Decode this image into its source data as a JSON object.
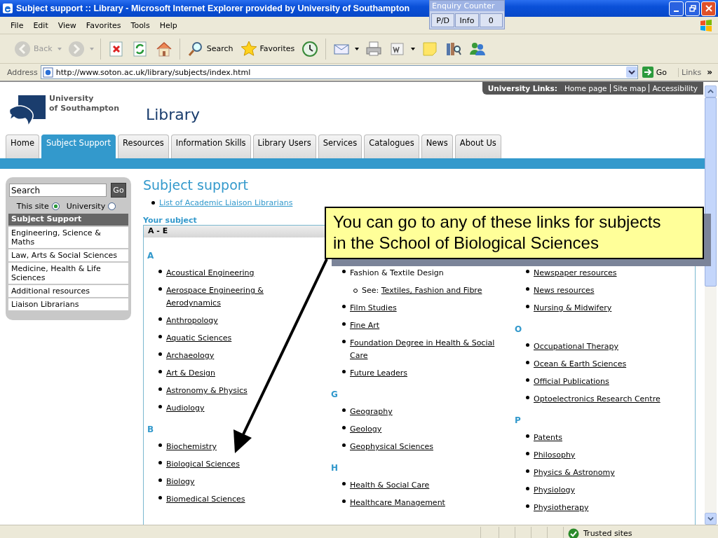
{
  "window": {
    "title": "Subject support :: Library - Microsoft Internet Explorer provided by University of Southampton"
  },
  "enquiry_counter": {
    "title": "Enquiry Counter",
    "buttons": [
      "P/D",
      "Info",
      "0"
    ]
  },
  "menu": [
    "File",
    "Edit",
    "View",
    "Favorites",
    "Tools",
    "Help"
  ],
  "toolbar": [
    {
      "kind": "back",
      "label": "Back",
      "disabled": true,
      "dropdown": true
    },
    {
      "kind": "forward",
      "disabled": true,
      "dropdown": true
    },
    {
      "kind": "stop",
      "disabled": false,
      "dropdown": false
    },
    {
      "kind": "refresh",
      "disabled": false,
      "dropdown": false
    },
    {
      "kind": "home",
      "disabled": false,
      "dropdown": false
    },
    {
      "kind": "search",
      "label": "Search",
      "disabled": false,
      "dropdown": false
    },
    {
      "kind": "favorites",
      "label": "Favorites",
      "disabled": false,
      "dropdown": false
    },
    {
      "kind": "history",
      "disabled": false,
      "dropdown": false
    },
    {
      "kind": "mail",
      "disabled": false,
      "dropdown": true
    },
    {
      "kind": "print",
      "disabled": false,
      "dropdown": false
    },
    {
      "kind": "edit",
      "disabled": false,
      "dropdown": true
    },
    {
      "kind": "note",
      "disabled": false,
      "dropdown": false
    },
    {
      "kind": "research",
      "disabled": false,
      "dropdown": false
    },
    {
      "kind": "messenger",
      "disabled": false,
      "dropdown": false
    }
  ],
  "address": {
    "label": "Address",
    "url": "http://www.soton.ac.uk/library/subjects/index.html",
    "go": "Go",
    "links": "Links",
    "more": "»"
  },
  "page": {
    "university_links": {
      "label": "University Links:",
      "links": [
        "Home page",
        "Site map",
        "Accessibility"
      ]
    },
    "logo_text": [
      "University",
      "of Southampton"
    ],
    "site_title": "Library",
    "tabs": [
      {
        "label": "Home",
        "selected": false
      },
      {
        "label": "Subject Support",
        "selected": true
      },
      {
        "label": "Resources",
        "selected": false
      },
      {
        "label": "Information Skills",
        "selected": false
      },
      {
        "label": "Library Users",
        "selected": false
      },
      {
        "label": "Services",
        "selected": false
      },
      {
        "label": "Catalogues",
        "selected": false
      },
      {
        "label": "News",
        "selected": false
      },
      {
        "label": "About Us",
        "selected": false
      }
    ],
    "sidebar": {
      "search_value": "Search",
      "go": "Go",
      "scopes": [
        {
          "label": "This site",
          "selected": true
        },
        {
          "label": "University",
          "selected": false
        }
      ],
      "heading": "Subject Support",
      "items": [
        "Engineering, Science & Maths",
        "Law, Arts & Social Sciences",
        "Medicine, Health & Life Sciences",
        "Additional resources",
        "Liaison Librarians"
      ]
    },
    "content": {
      "title": "Subject support",
      "links": [
        "List of Academic Liaison Librarians"
      ],
      "subheading": "Your subject",
      "panel_header": "A - E",
      "columns": [
        [
          {
            "heading": "A",
            "items": [
              {
                "kind": "link",
                "text": "Acoustical Engineering"
              },
              {
                "kind": "link",
                "text": "Aerospace Engineering & Aerodynamics"
              },
              {
                "kind": "link",
                "text": "Anthropology"
              },
              {
                "kind": "link",
                "text": "Aquatic Sciences"
              },
              {
                "kind": "link",
                "text": "Archaeology"
              },
              {
                "kind": "link",
                "text": "Art & Design"
              },
              {
                "kind": "link",
                "text": "Astronomy & Physics"
              },
              {
                "kind": "link",
                "text": "Audiology"
              }
            ]
          },
          {
            "heading": "B",
            "items": [
              {
                "kind": "link",
                "text": "Biochemistry"
              },
              {
                "kind": "link",
                "text": "Biological Sciences"
              },
              {
                "kind": "link",
                "text": "Biology"
              },
              {
                "kind": "link",
                "text": "Biomedical Sciences"
              }
            ]
          }
        ],
        [
          {
            "items": [
              {
                "kind": "plain",
                "text": "Fashion & Textile Design",
                "children": [
                  {
                    "prefix": "See:",
                    "text": "Textiles, Fashion and Fibre"
                  }
                ]
              },
              {
                "kind": "link",
                "text": "Film Studies"
              },
              {
                "kind": "link",
                "text": "Fine Art"
              },
              {
                "kind": "link",
                "text": "Foundation Degree in Health & Social Care"
              },
              {
                "kind": "link",
                "text": "Future Leaders"
              }
            ]
          },
          {
            "heading": "G",
            "items": [
              {
                "kind": "link",
                "text": "Geography"
              },
              {
                "kind": "link",
                "text": "Geology"
              },
              {
                "kind": "link",
                "text": "Geophysical Sciences"
              }
            ]
          },
          {
            "heading": "H",
            "items": [
              {
                "kind": "link",
                "text": "Health & Social Care"
              },
              {
                "kind": "link",
                "text": "Healthcare Management"
              }
            ]
          }
        ],
        [
          {
            "items": [
              {
                "kind": "link",
                "text": "Newspaper resources"
              },
              {
                "kind": "link",
                "text": "News resources"
              },
              {
                "kind": "link",
                "text": "Nursing & Midwifery"
              }
            ]
          },
          {
            "heading": "O",
            "items": [
              {
                "kind": "link",
                "text": "Occupational Therapy"
              },
              {
                "kind": "link",
                "text": "Ocean & Earth Sciences"
              },
              {
                "kind": "link",
                "text": "Official Publications"
              },
              {
                "kind": "link",
                "text": "Optoelectronics Research Centre"
              }
            ]
          },
          {
            "heading": "P",
            "items": [
              {
                "kind": "link",
                "text": "Patents"
              },
              {
                "kind": "link",
                "text": "Philosophy"
              },
              {
                "kind": "link",
                "text": "Physics & Astronomy"
              },
              {
                "kind": "link",
                "text": "Physiology"
              },
              {
                "kind": "link",
                "text": "Physiotherapy"
              }
            ]
          }
        ]
      ]
    },
    "callout": "You can go to any of these links for subjects in the School of Biological Sciences"
  },
  "status_bar": {
    "zone": "Trusted sites"
  }
}
